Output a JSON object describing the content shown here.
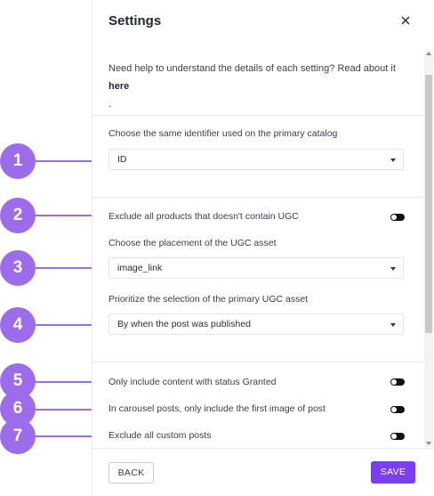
{
  "colors": {
    "accent": "#7b3ff2",
    "callout": "#9d6cea",
    "toggle": "#111111"
  },
  "dialog": {
    "title": "Settings",
    "close_icon": "close-icon",
    "help_text": "Need help to understand the details of each setting? Read about it ",
    "help_link": "here",
    "help_trailing": "."
  },
  "settings": {
    "identifier_label": "Choose the same identifier used on the primary catalog",
    "identifier_value": "ID",
    "exclude_no_ugc_label": "Exclude all products that doesn't contain UGC",
    "placement_label": "Choose the placement of the UGC asset",
    "placement_value": "image_link",
    "prioritize_label": "Prioritize the selection of the primary UGC asset",
    "prioritize_value": "By when the post was published",
    "granted_label": "Only include content with status Granted",
    "carousel_label": "In carousel posts, only include the first image of post",
    "custom_posts_label": "Exclude all custom posts"
  },
  "footer": {
    "back_label": "BACK",
    "save_label": "SAVE"
  },
  "callouts": [
    "1",
    "2",
    "3",
    "4",
    "5",
    "6",
    "7"
  ]
}
